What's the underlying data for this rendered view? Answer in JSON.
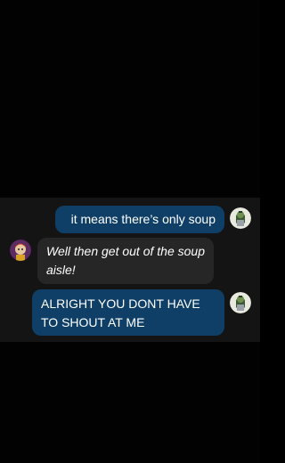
{
  "chat": {
    "messages": [
      {
        "side": "right",
        "style": "blue",
        "text": "it means there’s only soup",
        "avatar_icon": "character-avatar-green-icon"
      },
      {
        "side": "left",
        "style": "dark-italic",
        "text": "Well then get out of the soup aisle!",
        "avatar_icon": "character-avatar-purple-icon"
      },
      {
        "side": "right",
        "style": "blue",
        "text": "ALRIGHT YOU DONT HAVE TO SHOUT AT ME",
        "avatar_icon": "character-avatar-green-icon"
      }
    ]
  },
  "colors": {
    "background": "#020202",
    "chat_panel": "#141414",
    "blue_bubble": "#0f3f66",
    "dark_bubble": "#262626",
    "text": "#ffffff"
  }
}
